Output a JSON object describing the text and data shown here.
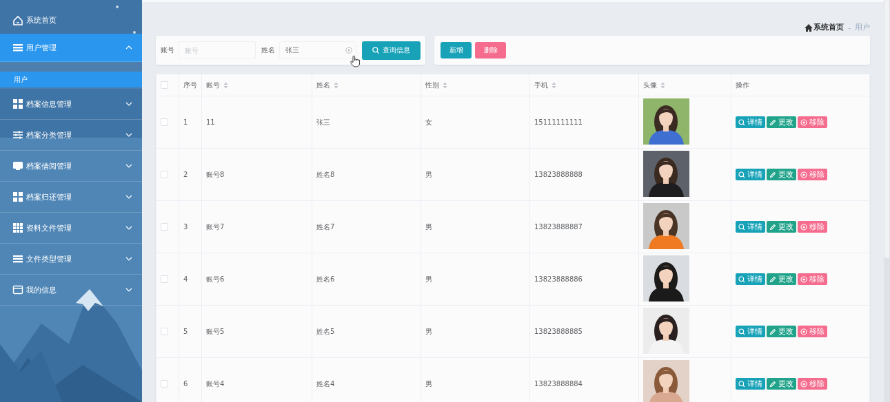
{
  "sidebar": {
    "items": [
      {
        "label": "系统首页",
        "selected": false
      },
      {
        "label": "用户管理",
        "selected": true,
        "expanded": true,
        "children": [
          {
            "label": "用户",
            "selected": true
          }
        ]
      },
      {
        "label": "档案信息管理",
        "selected": false,
        "expanded": false
      },
      {
        "label": "档案分类管理",
        "selected": false,
        "expanded": false
      },
      {
        "label": "档案借阅管理",
        "selected": false,
        "expanded": false
      },
      {
        "label": "档案归还管理",
        "selected": false,
        "expanded": false
      },
      {
        "label": "资料文件管理",
        "selected": false,
        "expanded": false
      },
      {
        "label": "文件类型管理",
        "selected": false,
        "expanded": false
      },
      {
        "label": "我的信息",
        "selected": false,
        "expanded": false
      }
    ]
  },
  "breadcrumb": {
    "items": [
      "系统首页",
      "用户"
    ],
    "separator": "-"
  },
  "search": {
    "fields": [
      {
        "label": "账号",
        "placeholder": "账号"
      },
      {
        "label": "姓名",
        "value": "张三"
      }
    ],
    "button": "查询信息"
  },
  "actions": [
    {
      "label": "新增",
      "kind": "primary"
    },
    {
      "label": "删除",
      "kind": "danger"
    }
  ],
  "table": {
    "header_checked": false,
    "columns": [
      {
        "label": "序号",
        "sortable": false
      },
      {
        "label": "账号",
        "sortable": true
      },
      {
        "label": "姓名",
        "sortable": true
      },
      {
        "label": "性别",
        "sortable": true
      },
      {
        "label": "手机",
        "sortable": true
      },
      {
        "label": "头像",
        "sortable": true
      },
      {
        "label": "操作",
        "sortable": false
      }
    ],
    "rows": [
      {
        "checked": false,
        "cells": [
          "1",
          "11",
          "张三",
          "女",
          "15111111111"
        ],
        "photo": {
          "kind": "picture"
        },
        "actions": [
          {
            "label": "详情",
            "kind": "detail"
          },
          {
            "label": "更改",
            "kind": "edit"
          },
          {
            "label": "移除",
            "kind": "remove"
          }
        ]
      },
      {
        "checked": false,
        "cells": [
          "2",
          "账号8",
          "姓名8",
          "男",
          "13823888888"
        ],
        "photo": {
          "kind": "picture"
        },
        "actions": [
          {
            "label": "详情",
            "kind": "detail"
          },
          {
            "label": "更改",
            "kind": "edit"
          },
          {
            "label": "移除",
            "kind": "remove"
          }
        ]
      },
      {
        "checked": false,
        "cells": [
          "3",
          "账号7",
          "姓名7",
          "男",
          "13823888887"
        ],
        "photo": {
          "kind": "picture"
        },
        "actions": [
          {
            "label": "详情",
            "kind": "detail"
          },
          {
            "label": "更改",
            "kind": "edit"
          },
          {
            "label": "移除",
            "kind": "remove"
          }
        ]
      },
      {
        "checked": false,
        "cells": [
          "4",
          "账号6",
          "姓名6",
          "男",
          "13823888886"
        ],
        "photo": {
          "kind": "picture"
        },
        "actions": [
          {
            "label": "详情",
            "kind": "detail"
          },
          {
            "label": "更改",
            "kind": "edit"
          },
          {
            "label": "移除",
            "kind": "remove"
          }
        ]
      },
      {
        "checked": false,
        "cells": [
          "5",
          "账号5",
          "姓名5",
          "男",
          "13823888885"
        ],
        "photo": {
          "kind": "picture"
        },
        "actions": [
          {
            "label": "详情",
            "kind": "detail"
          },
          {
            "label": "更改",
            "kind": "edit"
          },
          {
            "label": "移除",
            "kind": "remove"
          }
        ]
      },
      {
        "checked": false,
        "cells": [
          "6",
          "账号4",
          "姓名4",
          "男",
          "13823888884"
        ],
        "photo": {
          "kind": "picture"
        },
        "actions": [
          {
            "label": "详情",
            "kind": "detail"
          },
          {
            "label": "更改",
            "kind": "edit"
          },
          {
            "label": "移除",
            "kind": "remove"
          }
        ]
      }
    ]
  }
}
